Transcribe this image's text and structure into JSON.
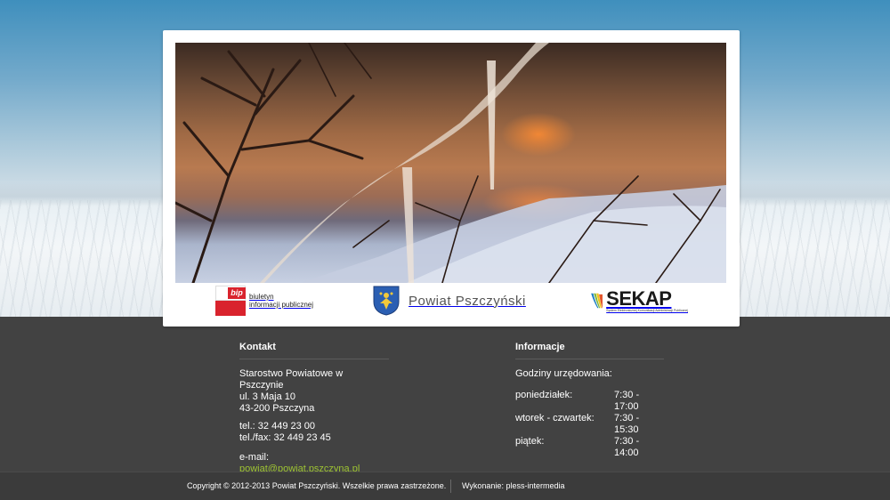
{
  "logos": {
    "bip": {
      "line1": "biuletyn",
      "line2": "informacji publicznej",
      "badge": "bip"
    },
    "powiat": {
      "name": "Powiat Pszczyński"
    },
    "sekap": {
      "name": "SEKAP",
      "sub": "System Elektronicznej Komunikacji Administracji Publicznej"
    }
  },
  "contact": {
    "heading": "Kontakt",
    "name": "Starostwo Powiatowe w Pszczynie",
    "street": "ul. 3 Maja 10",
    "city": "43-200 Pszczyna",
    "phone": "tel.: 32 449 23 00",
    "fax": "tel./fax: 32 449 23 45",
    "email_label": "e-mail: ",
    "email": "powiat@powiat.pszczyna.pl"
  },
  "info": {
    "heading": "Informacje",
    "hours_intro": "Godziny urzędowania:",
    "hours": [
      {
        "day": "poniedziałek:",
        "time": "7:30 - 17:00"
      },
      {
        "day": "wtorek - czwartek:",
        "time": "7:30 - 15:30"
      },
      {
        "day": "piątek:",
        "time": "7:30 - 14:00"
      }
    ]
  },
  "footer": {
    "copyright": "Copyright © 2012-2013 Powiat Pszczyński. Wszelkie prawa zastrzeżone.",
    "credit_label": "Wykonanie: ",
    "credit_name": "pless-intermedia"
  },
  "colors": {
    "footer_bg": "#424242",
    "link_green": "#9ec433",
    "bip_red": "#d9232d"
  }
}
